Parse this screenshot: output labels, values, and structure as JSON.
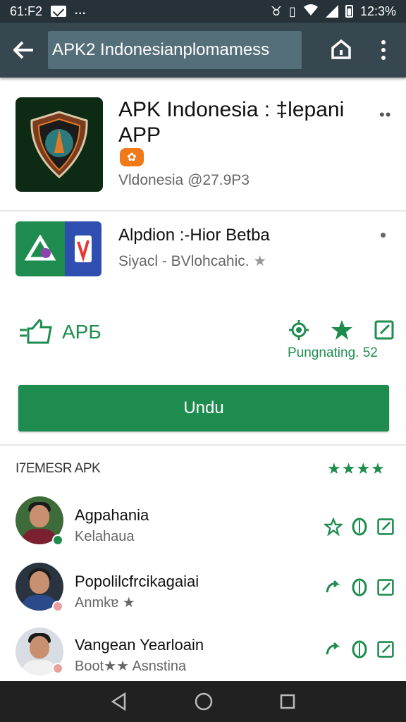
{
  "status_bar": {
    "time": "61:F2",
    "clock": "12:3%",
    "more": "..."
  },
  "toolbar": {
    "search_text": "APK2 Indonesianplomamess"
  },
  "app": {
    "title": "APK Indonesia : ‡lepani APP",
    "subtitle": "Vldonesia @27.9P3",
    "overflow": "••",
    "badge_icon": "leaf-icon"
  },
  "app2": {
    "title": "Alpdion :‑Hior Betba",
    "subtitle": "Siyacl - BVlohcahic.",
    "star": "★"
  },
  "actions": {
    "like_label": "APБ",
    "rating_text": "Pungnating. 52"
  },
  "install_button": "Undu",
  "reviews": {
    "header": "I7EMESR APK",
    "header_stars": "★★★★",
    "items": [
      {
        "name": "Agpahania",
        "sub": "Kelahaua",
        "badge_color": "#1e8c4f"
      },
      {
        "name": "Popolilcfrcikagaiai",
        "sub": "Anmkɐ ★",
        "badge_color": "#e8a0a0"
      },
      {
        "name": "Vangean Yearloain",
        "sub": "Boot★★ Asnstina",
        "badge_color": "#e8a0a0"
      }
    ]
  },
  "colors": {
    "accent": "#1e8c4f",
    "toolbar": "#37474f",
    "status_bar": "#263238",
    "nav_bar": "#212121"
  }
}
